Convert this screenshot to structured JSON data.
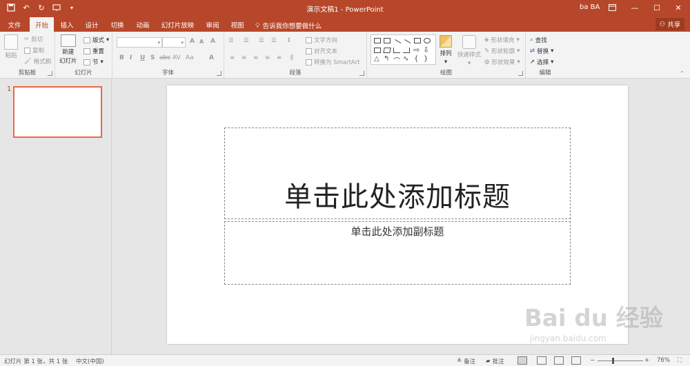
{
  "window": {
    "title": "演示文稿1  -  PowerPoint",
    "user": "ba BA"
  },
  "tabs": [
    "文件",
    "开始",
    "插入",
    "设计",
    "切换",
    "动画",
    "幻灯片放映",
    "审阅",
    "视图"
  ],
  "tell_me": "告诉我你想要做什么",
  "share_label": "共享",
  "ribbon": {
    "clipboard": {
      "label": "剪贴板",
      "paste": "粘贴",
      "cut": "剪切",
      "copy": "复制",
      "format_painter": "格式刷"
    },
    "slides": {
      "label": "幻灯片",
      "new_slide_1": "新建",
      "new_slide_2": "幻灯片",
      "layout": "版式",
      "reset": "重置",
      "section": "节"
    },
    "font": {
      "label": "字体",
      "bold": "B",
      "italic": "I",
      "underline": "U",
      "shadow": "S",
      "strike": "abc",
      "spacing": "AV",
      "case": "Aa",
      "clear": "A",
      "grow": "A",
      "shrink": "A"
    },
    "paragraph": {
      "label": "段落",
      "text_direction": "文字方向",
      "align_text": "对齐文本",
      "smartart": "转换为 SmartArt"
    },
    "drawing": {
      "label": "绘图",
      "arrange": "排列",
      "quick_styles": "快速样式",
      "shape_fill": "形状填充",
      "shape_outline": "形状轮廓",
      "shape_effects": "形状效果"
    },
    "editing": {
      "label": "编辑",
      "find": "查找",
      "replace": "替换",
      "select": "选择"
    }
  },
  "thumbnail": {
    "number": "1"
  },
  "slide": {
    "title_placeholder": "单击此处添加标题",
    "subtitle_placeholder": "单击此处添加副标题"
  },
  "status": {
    "slide_info": "幻灯片 第 1 张，共 1 张",
    "language": "中文(中国)",
    "notes": "备注",
    "comments": "批注",
    "zoom": "76%"
  },
  "watermark": {
    "main": "Bai du 经验",
    "sub": "jingyan.baidu.com"
  },
  "colors": {
    "accent": "#b7472a",
    "thumb_border": "#e56b4b"
  }
}
